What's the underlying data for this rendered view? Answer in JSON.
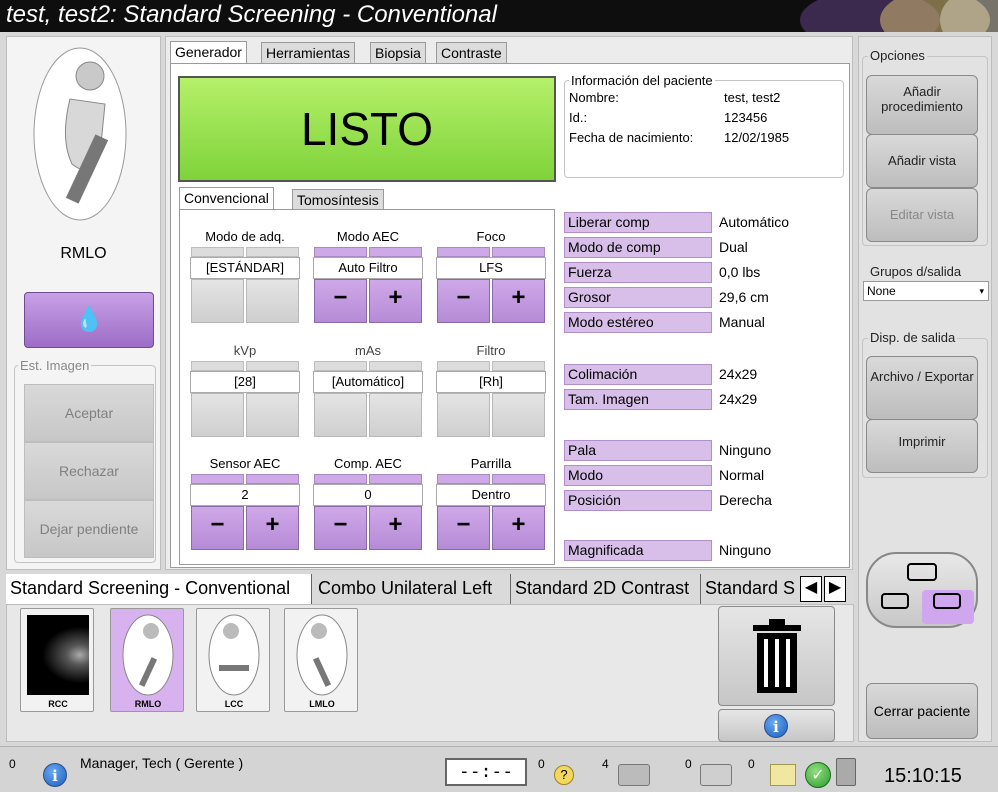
{
  "window": {
    "title": "test, test2:  Standard Screening - Conventional"
  },
  "left": {
    "view_label": "RMLO",
    "image_status_header": "Est. Imagen",
    "accept_label": "Aceptar",
    "reject_label": "Rechazar",
    "pending_label": "Dejar pendiente"
  },
  "tabs": [
    "Generador",
    "Herramientas",
    "Biopsia",
    "Contraste"
  ],
  "status_ready": "LISTO",
  "patient": {
    "header": "Información del paciente",
    "name_label": "Nombre:",
    "name": "test, test2",
    "id_label": "Id.:",
    "id": "123456",
    "dob_label": "Fecha de nacimiento:",
    "dob": "12/02/1985"
  },
  "subtabs": [
    "Convencional",
    "Tomosíntesis"
  ],
  "controls": {
    "acq_mode": {
      "label": "Modo de adq.",
      "value": "[ESTÁNDAR]"
    },
    "aec_mode": {
      "label": "Modo AEC",
      "value": "Auto Filtro"
    },
    "focus": {
      "label": "Foco",
      "value": "LFS"
    },
    "kvp": {
      "label": "kVp",
      "value": "[28]"
    },
    "mas": {
      "label": "mAs",
      "value": "[Automático]"
    },
    "filter": {
      "label": "Filtro",
      "value": "[Rh]"
    },
    "aec_sensor": {
      "label": "Sensor AEC",
      "value": "2"
    },
    "aec_comp": {
      "label": "Comp. AEC",
      "value": "0"
    },
    "grid": {
      "label": "Parrilla",
      "value": "Dentro"
    },
    "minus": "−",
    "plus": "+"
  },
  "params": [
    {
      "label": "Liberar comp",
      "value": "Automático"
    },
    {
      "label": "Modo de comp",
      "value": "Dual"
    },
    {
      "label": "Fuerza",
      "value": "0,0 lbs"
    },
    {
      "label": "Grosor",
      "value": "29,6 cm"
    },
    {
      "label": "Modo estéreo",
      "value": "Manual"
    },
    {
      "label": "Colimación",
      "value": "24x29"
    },
    {
      "label": "Tam. Imagen",
      "value": "24x29"
    },
    {
      "label": "Pala",
      "value": "Ninguno"
    },
    {
      "label": "Modo",
      "value": "Normal"
    },
    {
      "label": "Posición",
      "value": "Derecha"
    },
    {
      "label": "Magnificada",
      "value": "Ninguno"
    }
  ],
  "right": {
    "options_header": "Opciones",
    "add_procedure": "Añadir procedimiento",
    "add_view": "Añadir vista",
    "edit_view": "Editar vista",
    "output_groups_header": "Grupos d/salida",
    "output_group_selected": "None",
    "output_devices_header": "Disp. de salida",
    "archive_export": "Archivo / Exportar",
    "print": "Imprimir",
    "close_patient": "Cerrar paciente"
  },
  "procedures": [
    "Standard Screening - Conventional",
    "Combo Unilateral Left",
    "Standard 2D Contrast",
    "Standard S"
  ],
  "thumbnails": [
    "RCC",
    "RMLO",
    "LCC",
    "LMLO"
  ],
  "status": {
    "user": "Manager, Tech ( Gerente )",
    "timer": "--:--",
    "count_info": "0",
    "count_help": "0",
    "count_images": "4",
    "count_archive": "0",
    "count_print": "0",
    "clock": "15:10:15"
  },
  "colors": {
    "ready_green": "#9be353",
    "accent_purple": "#c59de3",
    "title_bg": "#0e0e0e"
  }
}
